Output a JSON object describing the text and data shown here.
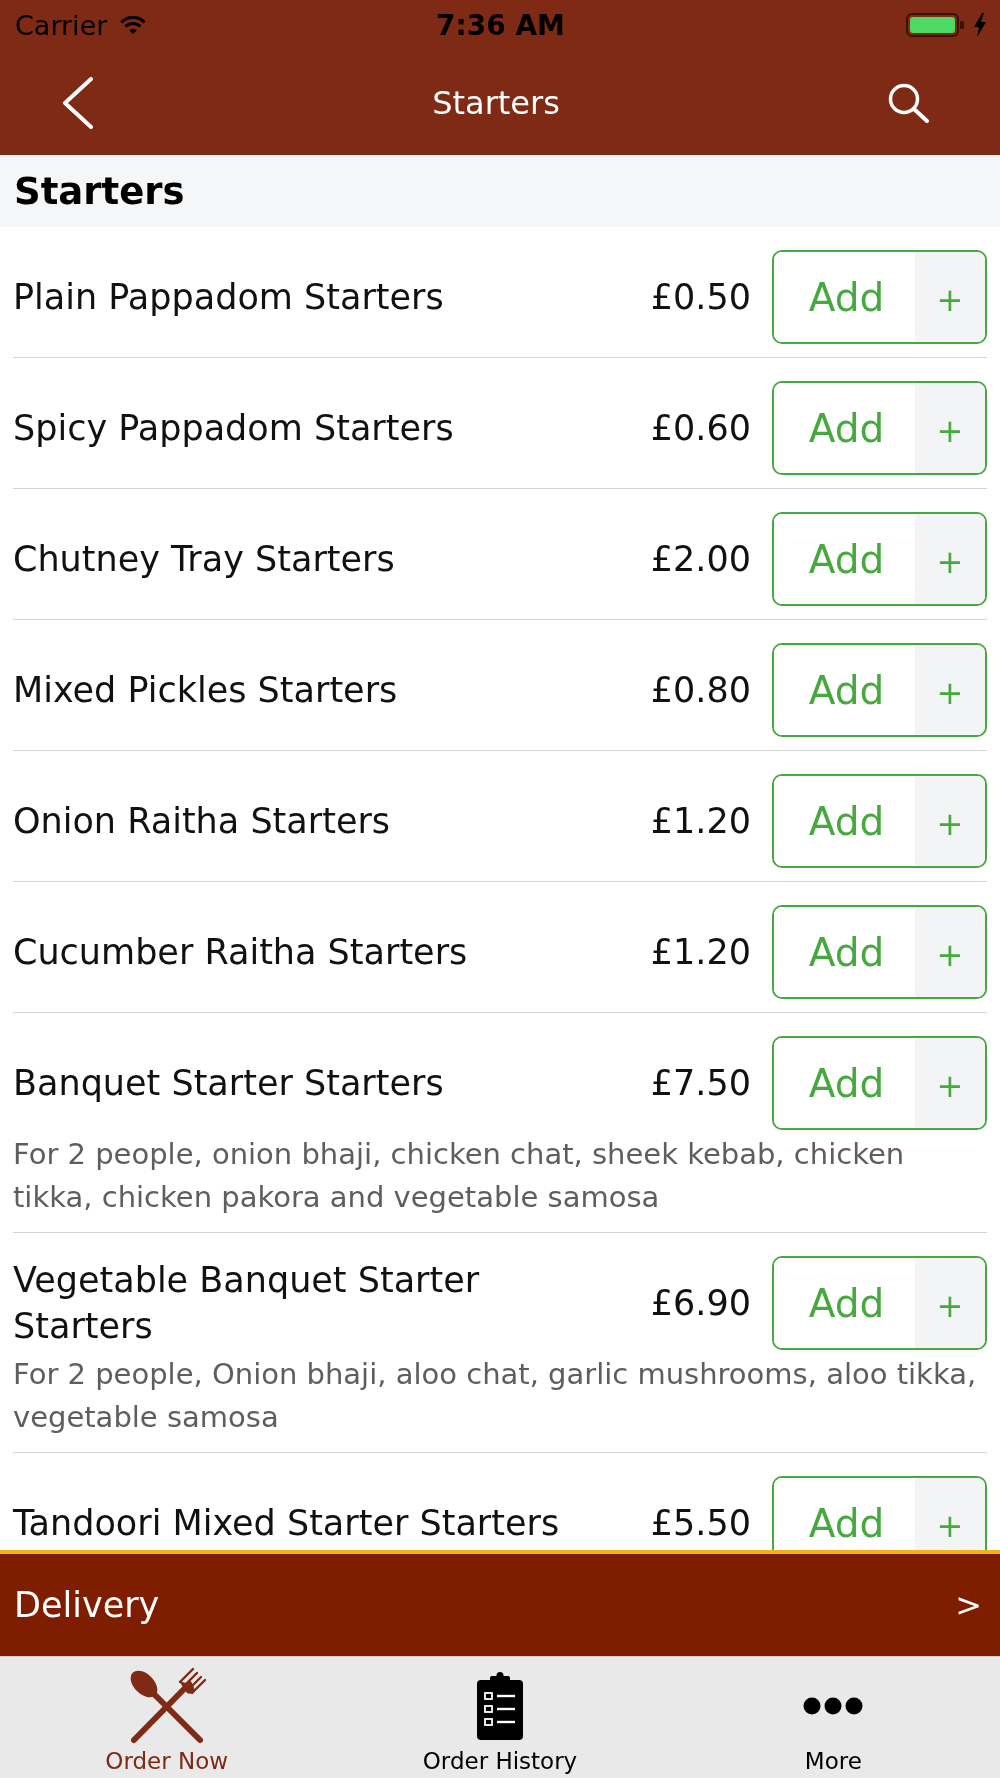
{
  "status_bar": {
    "carrier": "Carrier",
    "time": "7:36 AM"
  },
  "nav_bar": {
    "title": "Starters"
  },
  "section": {
    "title": "Starters"
  },
  "items": [
    {
      "name": "Plain Pappadom Starters",
      "price": "£0.50",
      "button": "Add",
      "stepper": "+"
    },
    {
      "name": "Spicy Pappadom Starters",
      "price": "£0.60",
      "button": "Add",
      "stepper": "+"
    },
    {
      "name": "Chutney Tray Starters",
      "price": "£2.00",
      "button": "Add",
      "stepper": "+"
    },
    {
      "name": "Mixed Pickles Starters",
      "price": "£0.80",
      "button": "Add",
      "stepper": "+"
    },
    {
      "name": "Onion Raitha Starters",
      "price": "£1.20",
      "button": "Add",
      "stepper": "+"
    },
    {
      "name": "Cucumber Raitha Starters",
      "price": "£1.20",
      "button": "Add",
      "stepper": "+"
    },
    {
      "name": "Banquet Starter Starters",
      "price": "£7.50",
      "button": "Add",
      "stepper": "+",
      "description": "For 2 people, onion bhaji, chicken chat, sheek kebab, chicken tikka, chicken pakora and vegetable samosa"
    },
    {
      "name": "Vegetable Banquet Starter Starters",
      "price": "£6.90",
      "button": "Add",
      "stepper": "+",
      "description": "For 2 people, Onion bhaji, aloo chat, garlic mushrooms, aloo tikka, vegetable samosa"
    },
    {
      "name": "Tandoori Mixed Starter Starters",
      "price": "£5.50",
      "button": "Add",
      "stepper": "+"
    }
  ],
  "delivery_bar": {
    "label": "Delivery",
    "arrow": ">"
  },
  "tab_bar": {
    "tabs": [
      {
        "label": "Order Now",
        "selected": true
      },
      {
        "label": "Order History",
        "selected": false
      },
      {
        "label": "More",
        "selected": false
      }
    ]
  }
}
